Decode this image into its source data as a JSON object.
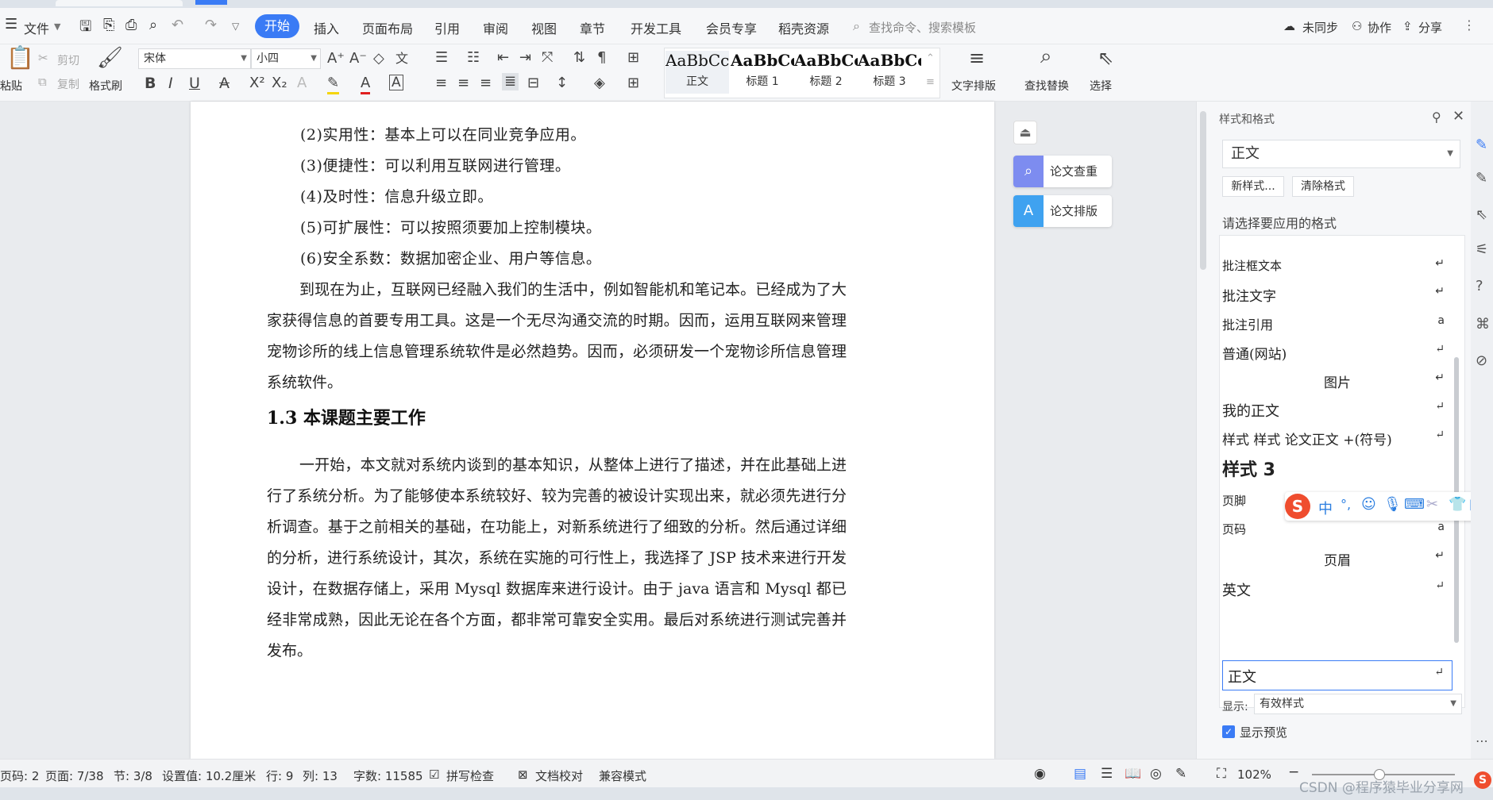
{
  "menubar": {
    "file_label": "文件",
    "tabs": [
      "开始",
      "插入",
      "页面布局",
      "引用",
      "审阅",
      "视图",
      "章节",
      "开发工具",
      "会员专享",
      "稻壳资源"
    ],
    "search_placeholder": "查找命令、搜索模板",
    "right": {
      "sync": "未同步",
      "collab": "协作",
      "share": "分享"
    }
  },
  "ribbon": {
    "paste": "粘贴",
    "cut": "剪切",
    "copy": "复制",
    "format_painter": "格式刷",
    "font_name": "宋体",
    "font_size": "小四",
    "styles": [
      {
        "preview": "AaBbCcI",
        "name": "正文"
      },
      {
        "preview": "AaBbCcI",
        "name": "标题 1"
      },
      {
        "preview": "AaBbCcI",
        "name": "标题 2"
      },
      {
        "preview": "AaBbCc",
        "name": "标题 3"
      }
    ],
    "text_layout": "文字排版",
    "find_replace": "查找替换",
    "select": "选择"
  },
  "document": {
    "items": [
      "(2)实用性：基本上可以在同业竞争应用。",
      "(3)便捷性：可以利用互联网进行管理。",
      "(4)及时性：信息升级立即。",
      "(5)可扩展性：可以按照须要加上控制模块。",
      "(6)安全系数：数据加密企业、用户等信息。"
    ],
    "para1": "到现在为止，互联网已经融入我们的生活中，例如智能机和笔记本。已经成为了大家获得信息的首要专用工具。这是一个无尽沟通交流的时期。因而，运用互联网来管理宠物诊所的线上信息管理系统软件是必然趋势。因而，必须研发一个宠物诊所信息管理系统软件。",
    "heading": "1.3  本课题主要工作",
    "para2": "一开始，本文就对系统内谈到的基本知识，从整体上进行了描述，并在此基础上进行了系统分析。为了能够使本系统较好、较为完善的被设计实现出来，就必须先进行分析调查。基于之前相关的基础，在功能上，对新系统进行了细致的分析。然后通过详细的分析，进行系统设计，其次，系统在实施的可行性上，我选择了 JSP 技术来进行开发设计，在数据存储上，采用 Mysql 数据库来进行设计。由于 java 语言和 Mysql 都已经非常成熟，因此无论在各个方面，都非常可靠安全实用。最后对系统进行测试完善并发布。"
  },
  "side_buttons": {
    "check": "论文查重",
    "layout": "论文排版"
  },
  "panel": {
    "title": "样式和格式",
    "current_style": "正文",
    "new_style": "新样式...",
    "clear_format": "清除格式",
    "prompt": "请选择要应用的格式",
    "items": [
      {
        "label": "批注框文本",
        "mark": "↵"
      },
      {
        "label": "批注文字",
        "mark": "↵"
      },
      {
        "label": "批注引用",
        "mark": "a"
      },
      {
        "label": "普通(网站)",
        "mark": "↵"
      },
      {
        "label": "图片",
        "mark": "↵"
      },
      {
        "label": "我的正文",
        "mark": "↵"
      },
      {
        "label": "样式 样式 论文正文 +(符号)",
        "mark": "↵"
      },
      {
        "label": "样式 3",
        "mark": ""
      },
      {
        "label": "页脚",
        "mark": "↵"
      },
      {
        "label": "页码",
        "mark": "a"
      },
      {
        "label": "页眉",
        "mark": "↵"
      },
      {
        "label": "英文",
        "mark": "↵"
      },
      {
        "label": "正文",
        "mark": "↵"
      }
    ],
    "show_label": "显示:",
    "show_value": "有效样式",
    "preview_label": "显示预览"
  },
  "ime": {
    "lang": "中"
  },
  "status": {
    "page_code": "页码: 2",
    "page": "页面: 7/38",
    "section": "节: 3/8",
    "setting": "设置值: 10.2厘米",
    "row": "行: 9",
    "col": "列: 13",
    "words": "字数: 11585",
    "spell": "拼写检查",
    "proof": "文档校对",
    "compat": "兼容模式",
    "zoom": "102%",
    "watermark": "CSDN @程序猿毕业分享网"
  },
  "colors": {
    "accent": "#3a7bf5",
    "ime_red": "#ef4d2e",
    "ime_blue": "#2b7ee0"
  }
}
